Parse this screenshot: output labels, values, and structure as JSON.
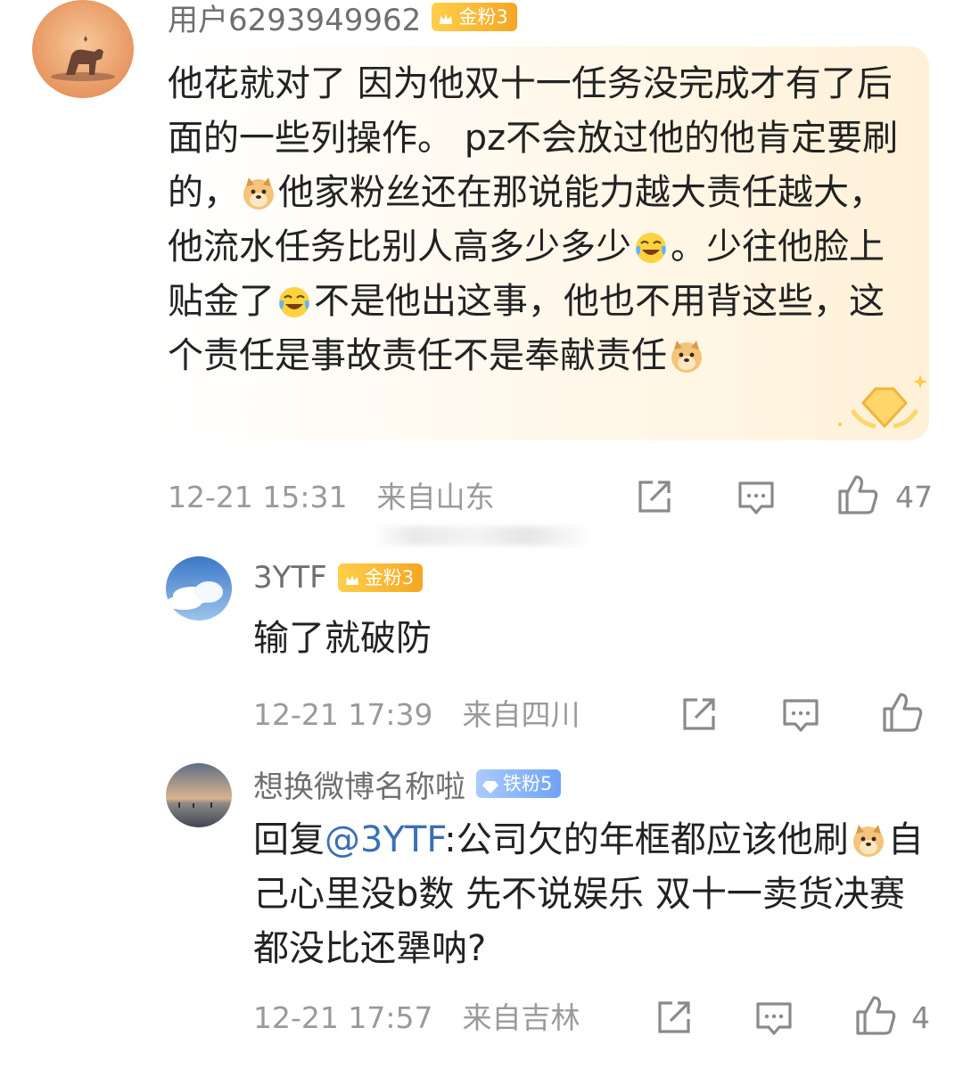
{
  "main_comment": {
    "username": "用户6293949962",
    "badge": "金粉3",
    "segments": [
      {
        "t": "他花就对了 因为他双十一任务没完成才有了后面的一些列操作。 pz不会放过他的他肯定要刷的，"
      },
      {
        "e": "doge"
      },
      {
        "t": "他家粉丝还在那说能力越大责任越大，他流水任务比别人高多少多少"
      },
      {
        "e": "laugh-cry"
      },
      {
        "t": "。少往他脸上贴金了"
      },
      {
        "e": "laugh-cry"
      },
      {
        "t": "不是他出这事，他也不用背这些，这个责任是事故责任不是奉献责任"
      },
      {
        "e": "doge"
      }
    ],
    "time": "12-21 15:31",
    "location": "来自山东",
    "like_count": "47"
  },
  "replies": [
    {
      "username": "3YTF",
      "badge": "金粉3",
      "segments": [
        {
          "t": "输了就破防"
        }
      ],
      "time": "12-21 17:39",
      "location": "来自四川",
      "like_count": ""
    },
    {
      "username": "想换微博名称啦",
      "badge": "铁粉5",
      "segments": [
        {
          "t": "回复"
        },
        {
          "m": "@3YTF"
        },
        {
          "t": ":公司欠的年框都应该他刷"
        },
        {
          "e": "doge"
        },
        {
          "t": "自己心里没b数 先不说娱乐 双十一卖货决赛都没比还犟呐?"
        }
      ],
      "time": "12-21 17:57",
      "location": "来自吉林",
      "like_count": "4"
    }
  ],
  "icons": {
    "share": "share-icon",
    "comment": "comment-icon",
    "like": "thumbs-up-icon"
  },
  "colors": {
    "gold_badge": "#f5a623",
    "iron_badge": "#6fa2f6",
    "mention": "#3b6fb6",
    "meta_text": "#9a9a9a"
  }
}
